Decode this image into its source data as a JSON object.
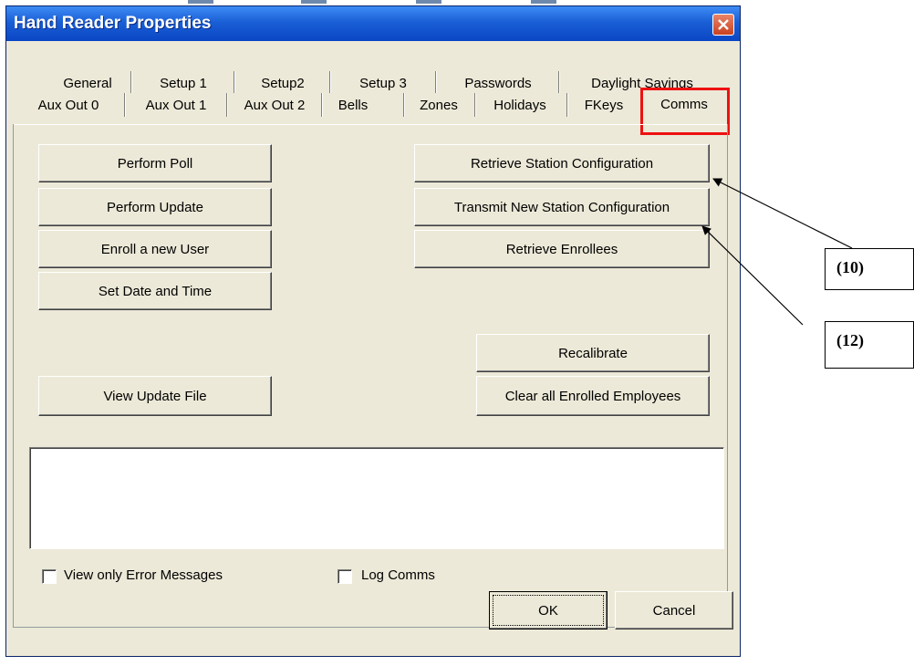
{
  "window": {
    "title": "Hand Reader Properties"
  },
  "tabs_row1": [
    "General",
    "Setup 1",
    "Setup2",
    "Setup 3",
    "Passwords",
    "Daylight Savings"
  ],
  "tabs_row2": [
    "Aux Out 0",
    "Aux Out 1",
    "Aux Out 2",
    "Bells",
    "Zones",
    "Holidays",
    "FKeys",
    "Comms"
  ],
  "active_tab": "Comms",
  "buttons": {
    "perform_poll": "Perform Poll",
    "perform_update": "Perform Update",
    "enroll_user": "Enroll a new User",
    "set_date_time": "Set Date and Time",
    "view_update_file": "View Update File",
    "retrieve_station_config": "Retrieve Station Configuration",
    "transmit_station_config": "Transmit New Station Configuration",
    "retrieve_enrollees": "Retrieve Enrollees",
    "recalibrate": "Recalibrate",
    "clear_enrolled": "Clear all Enrolled Employees",
    "ok": "OK",
    "cancel": "Cancel"
  },
  "checkboxes": {
    "view_only_errors": {
      "label": "View only Error Messages",
      "checked": false
    },
    "log_comms": {
      "label": "Log Comms",
      "checked": false
    }
  },
  "callouts": {
    "c10": "(10)",
    "c12": "(12)"
  },
  "colors": {
    "highlight": "#ee1111",
    "titlebar": "#1a5fd6",
    "dialog_bg": "#ece9d8"
  }
}
